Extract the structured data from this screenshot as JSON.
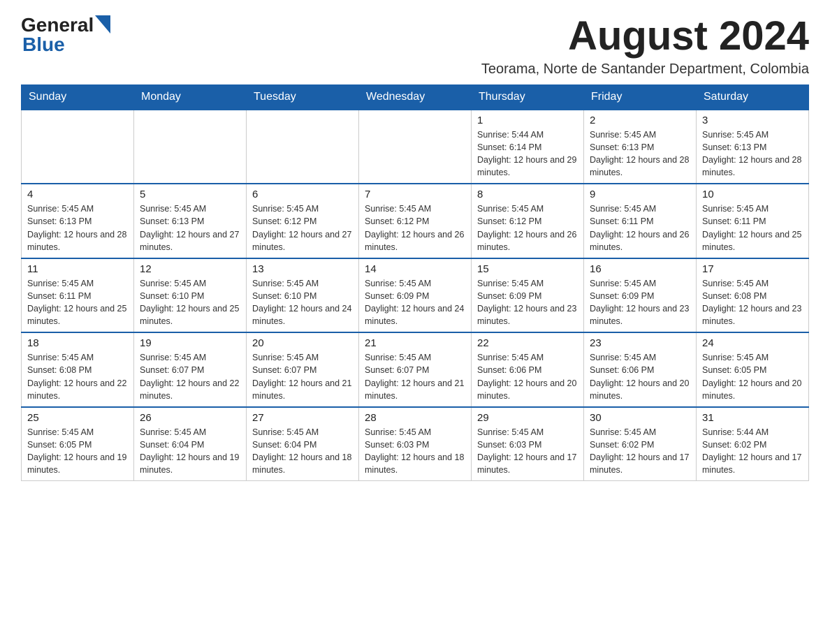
{
  "logo": {
    "general": "General",
    "blue": "Blue"
  },
  "header": {
    "month_year": "August 2024",
    "subtitle": "Teorama, Norte de Santander Department, Colombia"
  },
  "weekdays": [
    "Sunday",
    "Monday",
    "Tuesday",
    "Wednesday",
    "Thursday",
    "Friday",
    "Saturday"
  ],
  "weeks": [
    [
      {
        "day": "",
        "info": ""
      },
      {
        "day": "",
        "info": ""
      },
      {
        "day": "",
        "info": ""
      },
      {
        "day": "",
        "info": ""
      },
      {
        "day": "1",
        "info": "Sunrise: 5:44 AM\nSunset: 6:14 PM\nDaylight: 12 hours and 29 minutes."
      },
      {
        "day": "2",
        "info": "Sunrise: 5:45 AM\nSunset: 6:13 PM\nDaylight: 12 hours and 28 minutes."
      },
      {
        "day": "3",
        "info": "Sunrise: 5:45 AM\nSunset: 6:13 PM\nDaylight: 12 hours and 28 minutes."
      }
    ],
    [
      {
        "day": "4",
        "info": "Sunrise: 5:45 AM\nSunset: 6:13 PM\nDaylight: 12 hours and 28 minutes."
      },
      {
        "day": "5",
        "info": "Sunrise: 5:45 AM\nSunset: 6:13 PM\nDaylight: 12 hours and 27 minutes."
      },
      {
        "day": "6",
        "info": "Sunrise: 5:45 AM\nSunset: 6:12 PM\nDaylight: 12 hours and 27 minutes."
      },
      {
        "day": "7",
        "info": "Sunrise: 5:45 AM\nSunset: 6:12 PM\nDaylight: 12 hours and 26 minutes."
      },
      {
        "day": "8",
        "info": "Sunrise: 5:45 AM\nSunset: 6:12 PM\nDaylight: 12 hours and 26 minutes."
      },
      {
        "day": "9",
        "info": "Sunrise: 5:45 AM\nSunset: 6:11 PM\nDaylight: 12 hours and 26 minutes."
      },
      {
        "day": "10",
        "info": "Sunrise: 5:45 AM\nSunset: 6:11 PM\nDaylight: 12 hours and 25 minutes."
      }
    ],
    [
      {
        "day": "11",
        "info": "Sunrise: 5:45 AM\nSunset: 6:11 PM\nDaylight: 12 hours and 25 minutes."
      },
      {
        "day": "12",
        "info": "Sunrise: 5:45 AM\nSunset: 6:10 PM\nDaylight: 12 hours and 25 minutes."
      },
      {
        "day": "13",
        "info": "Sunrise: 5:45 AM\nSunset: 6:10 PM\nDaylight: 12 hours and 24 minutes."
      },
      {
        "day": "14",
        "info": "Sunrise: 5:45 AM\nSunset: 6:09 PM\nDaylight: 12 hours and 24 minutes."
      },
      {
        "day": "15",
        "info": "Sunrise: 5:45 AM\nSunset: 6:09 PM\nDaylight: 12 hours and 23 minutes."
      },
      {
        "day": "16",
        "info": "Sunrise: 5:45 AM\nSunset: 6:09 PM\nDaylight: 12 hours and 23 minutes."
      },
      {
        "day": "17",
        "info": "Sunrise: 5:45 AM\nSunset: 6:08 PM\nDaylight: 12 hours and 23 minutes."
      }
    ],
    [
      {
        "day": "18",
        "info": "Sunrise: 5:45 AM\nSunset: 6:08 PM\nDaylight: 12 hours and 22 minutes."
      },
      {
        "day": "19",
        "info": "Sunrise: 5:45 AM\nSunset: 6:07 PM\nDaylight: 12 hours and 22 minutes."
      },
      {
        "day": "20",
        "info": "Sunrise: 5:45 AM\nSunset: 6:07 PM\nDaylight: 12 hours and 21 minutes."
      },
      {
        "day": "21",
        "info": "Sunrise: 5:45 AM\nSunset: 6:07 PM\nDaylight: 12 hours and 21 minutes."
      },
      {
        "day": "22",
        "info": "Sunrise: 5:45 AM\nSunset: 6:06 PM\nDaylight: 12 hours and 20 minutes."
      },
      {
        "day": "23",
        "info": "Sunrise: 5:45 AM\nSunset: 6:06 PM\nDaylight: 12 hours and 20 minutes."
      },
      {
        "day": "24",
        "info": "Sunrise: 5:45 AM\nSunset: 6:05 PM\nDaylight: 12 hours and 20 minutes."
      }
    ],
    [
      {
        "day": "25",
        "info": "Sunrise: 5:45 AM\nSunset: 6:05 PM\nDaylight: 12 hours and 19 minutes."
      },
      {
        "day": "26",
        "info": "Sunrise: 5:45 AM\nSunset: 6:04 PM\nDaylight: 12 hours and 19 minutes."
      },
      {
        "day": "27",
        "info": "Sunrise: 5:45 AM\nSunset: 6:04 PM\nDaylight: 12 hours and 18 minutes."
      },
      {
        "day": "28",
        "info": "Sunrise: 5:45 AM\nSunset: 6:03 PM\nDaylight: 12 hours and 18 minutes."
      },
      {
        "day": "29",
        "info": "Sunrise: 5:45 AM\nSunset: 6:03 PM\nDaylight: 12 hours and 17 minutes."
      },
      {
        "day": "30",
        "info": "Sunrise: 5:45 AM\nSunset: 6:02 PM\nDaylight: 12 hours and 17 minutes."
      },
      {
        "day": "31",
        "info": "Sunrise: 5:44 AM\nSunset: 6:02 PM\nDaylight: 12 hours and 17 minutes."
      }
    ]
  ]
}
